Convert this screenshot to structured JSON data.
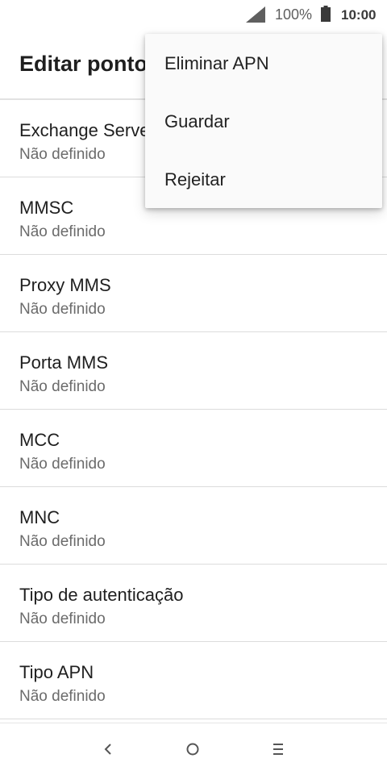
{
  "status_bar": {
    "battery_percent": "100%",
    "time": "10:00",
    "icons": [
      "signal-icon",
      "battery-icon"
    ]
  },
  "app_bar": {
    "title": "Editar ponto de acesso"
  },
  "list": {
    "items": [
      {
        "label": "Exchange Server",
        "summary": "Não definido"
      },
      {
        "label": "MMSC",
        "summary": "Não definido"
      },
      {
        "label": "Proxy MMS",
        "summary": "Não definido"
      },
      {
        "label": "Porta MMS",
        "summary": "Não definido"
      },
      {
        "label": "MCC",
        "summary": "Não definido"
      },
      {
        "label": "MNC",
        "summary": "Não definido"
      },
      {
        "label": "Tipo de autenticação",
        "summary": "Não definido"
      },
      {
        "label": "Tipo APN",
        "summary": "Não definido"
      }
    ]
  },
  "overflow_menu": {
    "items": [
      {
        "label": "Eliminar APN"
      },
      {
        "label": "Guardar"
      },
      {
        "label": "Rejeitar"
      }
    ]
  },
  "nav_bar": {
    "icons": [
      "back-icon",
      "home-icon",
      "recents-icon"
    ]
  }
}
